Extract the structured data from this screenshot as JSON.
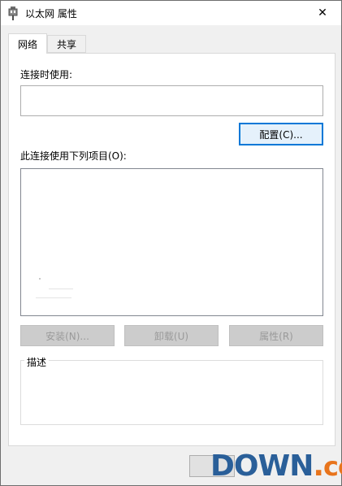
{
  "window": {
    "title": "以太网 属性",
    "close_glyph": "✕"
  },
  "tabs": [
    {
      "label": "网络",
      "active": true
    },
    {
      "label": "共享",
      "active": false
    }
  ],
  "connect_using": {
    "label": "连接时使用:",
    "value": ""
  },
  "configure_button": "配置(C)...",
  "items_label": "此连接使用下列项目(O):",
  "items": [],
  "buttons": {
    "install": "安装(N)...",
    "uninstall": "卸载(U)",
    "properties": "属性(R)"
  },
  "description": {
    "legend": "描述",
    "text": ""
  },
  "footer": {
    "ok_label": ""
  },
  "watermark": {
    "main": "DOWN",
    "dot": ".",
    "suffix": "cc"
  },
  "colors": {
    "accent": "#0078d7",
    "watermark_blue": "#2a5f99",
    "watermark_orange": "#e8741c"
  },
  "icons": {
    "title": "network-adapter-icon",
    "close": "close-icon"
  }
}
